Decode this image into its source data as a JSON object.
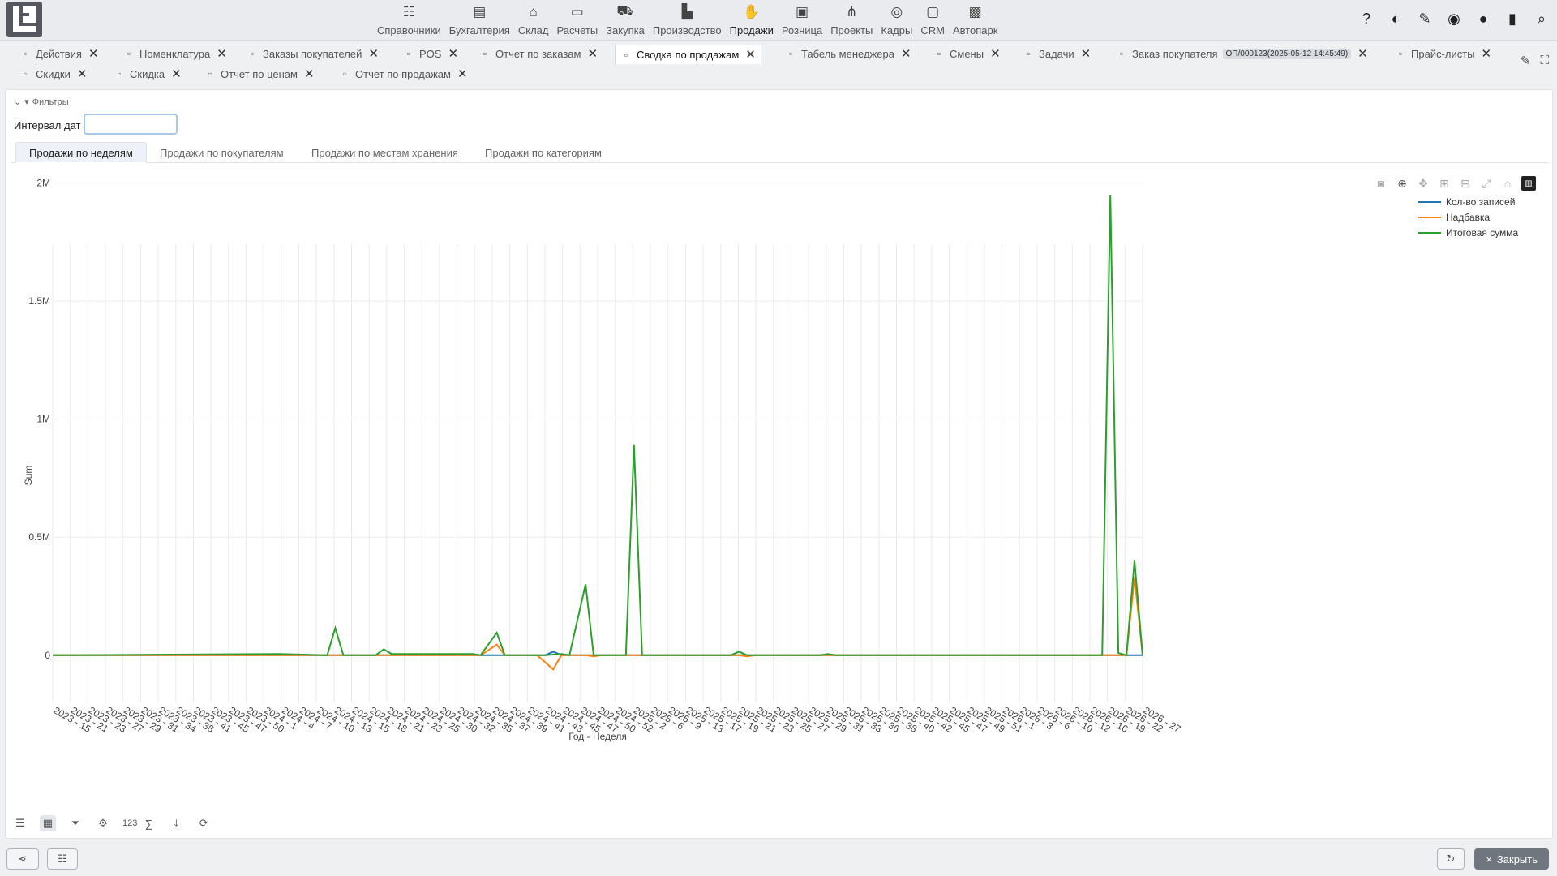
{
  "nav": {
    "items": [
      {
        "label": "Справочники",
        "icon": "checklist-icon"
      },
      {
        "label": "Бухгалтерия",
        "icon": "ledger-icon"
      },
      {
        "label": "Склад",
        "icon": "warehouse-icon"
      },
      {
        "label": "Расчеты",
        "icon": "money-icon"
      },
      {
        "label": "Закупка",
        "icon": "cart-icon"
      },
      {
        "label": "Производство",
        "icon": "factory-icon"
      },
      {
        "label": "Продажи",
        "icon": "sales-hand-icon"
      },
      {
        "label": "Розница",
        "icon": "shopping-bag-icon"
      },
      {
        "label": "Проекты",
        "icon": "project-tree-icon"
      },
      {
        "label": "Кадры",
        "icon": "fingerprint-icon"
      },
      {
        "label": "CRM",
        "icon": "contact-card-icon"
      },
      {
        "label": "Автопарк",
        "icon": "bus-icon"
      }
    ],
    "active": "Продажи"
  },
  "tabs": {
    "row1": [
      {
        "label": "Действия"
      },
      {
        "label": "Номенклатура"
      },
      {
        "label": "Заказы покупателей"
      },
      {
        "label": "POS"
      },
      {
        "label": "Отчет по заказам"
      },
      {
        "label": "Сводка по продажам",
        "active": true
      },
      {
        "label": "Табель менеджера"
      },
      {
        "label": "Смены"
      },
      {
        "label": "Задачи"
      },
      {
        "label": "Заказ покупателя",
        "badge": "ОП/000123(2025-05-12 14:45:49)"
      },
      {
        "label": "Прайс-листы"
      }
    ],
    "row2": [
      {
        "label": "Скидки"
      },
      {
        "label": "Скидка"
      },
      {
        "label": "Отчет по ценам"
      },
      {
        "label": "Отчет по продажам"
      }
    ]
  },
  "filters": {
    "label": "Фильтры",
    "interval_label": "Интервал дат",
    "interval_value": ""
  },
  "subtabs": [
    "Продажи по неделям",
    "Продажи по покупателям",
    "Продажи по местам хранения",
    "Продажи по категориям"
  ],
  "footer": {
    "count_label": "123",
    "sum_label": "∑"
  },
  "bottom": {
    "close_label": "Закрыть",
    "close_symbol": "×"
  },
  "chart_data": {
    "type": "line",
    "xlabel": "Год - Неделя",
    "ylabel": "Sum",
    "ylim": [
      -200000,
      2050000
    ],
    "yticks": [
      {
        "v": 0,
        "label": "0"
      },
      {
        "v": 500000,
        "label": "0.5M"
      },
      {
        "v": 1000000,
        "label": "1M"
      },
      {
        "v": 1500000,
        "label": "1.5M"
      },
      {
        "v": 2000000,
        "label": "2M"
      }
    ],
    "x_tick_labels": [
      "2023 - 15",
      "2023 - 21",
      "2023 - 23",
      "2023 - 27",
      "2023 - 29",
      "2023 - 31",
      "2023 - 34",
      "2023 - 38",
      "2023 - 41",
      "2023 - 45",
      "2023 - 47",
      "2023 - 50",
      "2024 - 1",
      "2024 - 4",
      "2024 - 7",
      "2024 - 10",
      "2024 - 13",
      "2024 - 15",
      "2024 - 18",
      "2024 - 21",
      "2024 - 23",
      "2024 - 25",
      "2024 - 30",
      "2024 - 32",
      "2024 - 35",
      "2024 - 37",
      "2024 - 39",
      "2024 - 41",
      "2024 - 43",
      "2024 - 45",
      "2024 - 47",
      "2024 - 50",
      "2024 - 52",
      "2025 - 2",
      "2025 - 6",
      "2025 - 9",
      "2025 - 13",
      "2025 - 17",
      "2025 - 19",
      "2025 - 21",
      "2025 - 23",
      "2025 - 25",
      "2025 - 27",
      "2025 - 29",
      "2025 - 31",
      "2025 - 33",
      "2025 - 36",
      "2025 - 38",
      "2025 - 40",
      "2025 - 42",
      "2025 - 45",
      "2025 - 47",
      "2025 - 49",
      "2025 - 51",
      "2026 - 1",
      "2026 - 3",
      "2026 - 6",
      "2026 - 10",
      "2026 - 12",
      "2026 - 16",
      "2026 - 19",
      "2026 - 22",
      "2026 - 27"
    ],
    "series": [
      {
        "name": "Кол-во записей",
        "color": "#1f77b4",
        "values": [
          0,
          0,
          0,
          0,
          0,
          0,
          0,
          0,
          0,
          0,
          0,
          0,
          0,
          0,
          0,
          0,
          0,
          0,
          0,
          0,
          0,
          0,
          0,
          0,
          0,
          0,
          0,
          0,
          0,
          0,
          0,
          0,
          0,
          0,
          0,
          0,
          0,
          0,
          0,
          0,
          0,
          0,
          0,
          0,
          0,
          0,
          0,
          0,
          0,
          0,
          0,
          0,
          0,
          0,
          0,
          0,
          0,
          0,
          0,
          0,
          0,
          0,
          0,
          0,
          0,
          0,
          0,
          0,
          0,
          0,
          0,
          0,
          0,
          0,
          0,
          0,
          0,
          0,
          0,
          0,
          0,
          0,
          0,
          0,
          0,
          0,
          0,
          0,
          0,
          0,
          0,
          0,
          0,
          0,
          0,
          0,
          0,
          0,
          0,
          0,
          0,
          0,
          0,
          0,
          0,
          0,
          0,
          0,
          0,
          0,
          0,
          0,
          0,
          0,
          0,
          0,
          0,
          0,
          0,
          0,
          0,
          0,
          0,
          0,
          0
        ]
      },
      {
        "name": "Надбавка",
        "color": "#ff7f0e",
        "values": [
          0,
          0,
          0,
          0,
          0,
          0,
          0,
          0,
          0,
          0,
          0,
          0,
          0,
          0,
          0,
          0,
          0,
          0,
          0,
          0,
          0,
          0,
          0,
          0,
          0,
          0,
          0,
          0,
          0,
          0,
          0,
          0,
          0,
          0,
          0,
          0,
          0,
          0,
          0,
          0,
          0,
          0,
          0,
          0,
          0,
          0,
          0,
          0,
          0,
          0,
          0,
          0,
          0,
          0,
          0,
          0,
          0,
          0,
          0,
          0,
          0,
          0,
          0,
          0,
          0,
          0,
          0,
          0,
          0,
          0,
          0,
          0,
          0,
          0,
          0,
          0,
          0,
          0,
          0,
          0,
          0,
          0,
          0,
          0,
          0,
          0,
          0,
          0,
          0,
          0,
          0,
          0,
          0,
          0,
          0,
          0,
          0,
          0,
          0,
          0,
          0,
          0,
          0,
          0,
          0,
          0,
          0,
          0,
          0,
          0,
          0,
          0,
          0,
          0,
          0,
          0,
          0,
          0,
          0,
          0,
          0,
          0,
          0,
          0,
          0
        ]
      },
      {
        "name": "Итоговая сумма",
        "color": "#2ca02c",
        "values": [
          0,
          0,
          0,
          0,
          0,
          0,
          0,
          0,
          0,
          0,
          0,
          0,
          0,
          0,
          0,
          0,
          0,
          0,
          0,
          0,
          0,
          0,
          0,
          0,
          0,
          0,
          0,
          0,
          0,
          0,
          0,
          0,
          0,
          0,
          0,
          0,
          0,
          0,
          0,
          0,
          0,
          0,
          0,
          0,
          0,
          0,
          0,
          0,
          0,
          0,
          0,
          0,
          0,
          0,
          0,
          0,
          0,
          0,
          0,
          0,
          0,
          0,
          0,
          0,
          0,
          0,
          0,
          0,
          0,
          0,
          0,
          0,
          0,
          0,
          0,
          0,
          0,
          0,
          0,
          0,
          0,
          0,
          0,
          0,
          0,
          0,
          0,
          0,
          0,
          0,
          0,
          0,
          0,
          0,
          0,
          0,
          0,
          0,
          0,
          0,
          0,
          0,
          0,
          0,
          0,
          0,
          0,
          0,
          0,
          0,
          0,
          0,
          0,
          0,
          0,
          0,
          0,
          0,
          0,
          0,
          0,
          0,
          0,
          0,
          0
        ]
      }
    ],
    "points": {
      "Итоговая сумма": [
        [
          0,
          0
        ],
        [
          28,
          5000
        ],
        [
          34,
          0
        ],
        [
          35,
          115000
        ],
        [
          36,
          0
        ],
        [
          40,
          0
        ],
        [
          41,
          25000
        ],
        [
          42,
          5000
        ],
        [
          52,
          5000
        ],
        [
          53,
          0
        ],
        [
          55,
          95000
        ],
        [
          56,
          0
        ],
        [
          60,
          0
        ],
        [
          61,
          0
        ],
        [
          63,
          5000
        ],
        [
          64,
          0
        ],
        [
          66,
          300000
        ],
        [
          67,
          0
        ],
        [
          71,
          0
        ],
        [
          72,
          890000
        ],
        [
          73,
          0
        ],
        [
          84,
          0
        ],
        [
          85,
          15000
        ],
        [
          86,
          0
        ],
        [
          95,
          0
        ],
        [
          96,
          5000
        ],
        [
          97,
          0
        ],
        [
          130,
          0
        ],
        [
          131,
          1950000
        ],
        [
          132,
          10000
        ],
        [
          133,
          0
        ],
        [
          134,
          400000
        ],
        [
          135,
          0
        ]
      ],
      "Надбавка": [
        [
          0,
          0
        ],
        [
          53,
          0
        ],
        [
          55,
          45000
        ],
        [
          56,
          0
        ],
        [
          60,
          0
        ],
        [
          62,
          -60000
        ],
        [
          63,
          0
        ],
        [
          65,
          0
        ],
        [
          66,
          0
        ],
        [
          67,
          -5000
        ],
        [
          68,
          0
        ],
        [
          84,
          0
        ],
        [
          85,
          0
        ],
        [
          86,
          -5000
        ],
        [
          87,
          0
        ],
        [
          133,
          0
        ],
        [
          134,
          330000
        ],
        [
          135,
          0
        ]
      ],
      "Кол-во записей": [
        [
          0,
          0
        ],
        [
          61,
          0
        ],
        [
          62,
          15000
        ],
        [
          63,
          0
        ],
        [
          135,
          0
        ]
      ]
    },
    "n_points": 136,
    "legend_position": "top-right"
  },
  "modebar": [
    "camera-icon",
    "zoom-icon",
    "pan-icon",
    "zoom-in-icon",
    "zoom-out-icon",
    "autoscale-icon",
    "home-icon",
    "plotly-logo-icon"
  ]
}
